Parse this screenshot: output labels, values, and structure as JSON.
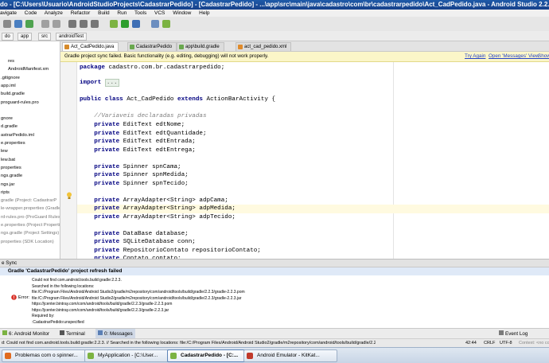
{
  "window": {
    "title": "do - [C:\\Users\\Usuario\\AndroidStudioProjects\\CadastrarPedido] - [CadastrarPedido] - ...\\app\\src\\main\\java\\cadastro\\com\\br\\cadastrarpedido\\Act_CadPedido.java - Android Studio 2.2.3"
  },
  "menu": [
    "avigate",
    "Code",
    "Analyze",
    "Refactor",
    "Build",
    "Run",
    "Tools",
    "VCS",
    "Window",
    "Help"
  ],
  "breadcrumbs": [
    "do",
    "app",
    "src",
    "androidTest"
  ],
  "project_tree": [
    {
      "label": "res",
      "style": "normal"
    },
    {
      "label": "AndroidManifest.xm",
      "style": "normal"
    },
    {
      "label": ".gitignore",
      "style": "normal"
    },
    {
      "label": "app.iml",
      "style": "normal"
    },
    {
      "label": "build.gradle",
      "style": "normal"
    },
    {
      "label": "proguard-rules.pro",
      "style": "normal"
    },
    {
      "label": "",
      "style": "normal"
    },
    {
      "label": "gnore",
      "style": "normal"
    },
    {
      "label": "d.gradle",
      "style": "normal"
    },
    {
      "label": "astrarPedido.iml",
      "style": "normal"
    },
    {
      "label": "e.properties",
      "style": "normal"
    },
    {
      "label": "lew",
      "style": "normal"
    },
    {
      "label": "lew.bat",
      "style": "normal"
    },
    {
      "label": "properties",
      "style": "normal"
    },
    {
      "label": "ngs.gradle",
      "style": "normal"
    },
    {
      "label": "ngs.jar",
      "style": "normal"
    },
    {
      "label": "ripts",
      "style": "normal"
    },
    {
      "label": "gradle (Project: CadastrarP",
      "style": "grey"
    },
    {
      "label": "le-wrapper.properties (Gradle",
      "style": "grey"
    },
    {
      "label": "rd-rules.pro (ProGuard Rules f",
      "style": "grey"
    },
    {
      "label": "e.properties (Project Propertie",
      "style": "grey"
    },
    {
      "label": "ngs.gradle (Project Settings)",
      "style": "grey"
    },
    {
      "label": "properties (SDK Location)",
      "style": "grey"
    }
  ],
  "editor_tabs": [
    {
      "label": "Act_CadPedido.java",
      "active": true,
      "color": "#d68a2a"
    },
    {
      "label": "CadastrarPedido",
      "active": false,
      "color": "#6aa84f"
    },
    {
      "label": "app\\build.gradle",
      "active": false,
      "color": "#6aa84f"
    },
    {
      "label": "act_cad_pedido.xml",
      "active": false,
      "color": "#e08b2b"
    }
  ],
  "notice": {
    "text": "Gradle project sync failed. Basic functionality (e.g. editing, debugging) will not work properly.",
    "try_again": "Try Again",
    "open_messages": "Open 'Messages' View",
    "show": "Show"
  },
  "code": {
    "package_kw": "package",
    "package_name": " cadastro.com.br.cadastrarpedido;",
    "import_kw": "import",
    "import_rest": "...",
    "class_decl_1": "public class",
    "class_decl_2": " Act_CadPedido ",
    "class_decl_3": "extends",
    "class_decl_4": " ActionBarActivity {",
    "comment": "//Variaveis declaradas privadas",
    "private_kw": "private",
    "fields": [
      " EditText edtNome;",
      " EditText edtQuantidade;",
      " EditText edtEntrada;",
      " EditText edtEntrega;",
      "",
      " Spinner spnCama;",
      " Spinner spnMedida;",
      " Spinner spnTecido;",
      "",
      " ArrayAdapter<String> adpCama;",
      " ArrayAdapter<String> adpMedida;",
      " ArrayAdapter<String> adpTecido;",
      "",
      " DataBase database;",
      " SQLiteDatabase conn;",
      " RepositorioContato repositorioContato;",
      " Contato contato;"
    ]
  },
  "sync": {
    "panel_label": "e Sync",
    "title": "Gradle 'CadastrarPedido' project refresh failed",
    "error_label": "Error:",
    "lines": [
      "Could not find com.android.tools.build:gradle:2.2.3.",
      "Searched in the following locations:",
      "file:/C:/Program Files/Android/Android Studio2/gradle/m2repository/com/android/tools/build/gradle/2.2.3/gradle-2.2.3.pom",
      "file:/C:/Program Files/Android/Android Studio2/gradle/m2repository/com/android/tools/build/gradle/2.2.3/gradle-2.2.3.jar",
      "https://jcenter.bintray.com/com/android/tools/build/gradle/2.2.3/gradle-2.2.3.pom",
      "https://jcenter.bintray.com/com/android/tools/build/gradle/2.2.3/gradle-2.2.3.jar",
      "Required by:",
      "  :CadastrarPedido:unspecified"
    ]
  },
  "bottom_tabs": {
    "android_monitor": "6: Android Monitor",
    "terminal": "Terminal",
    "messages": "0: Messages",
    "event_log": "Event Log",
    "gradle_console": "Gradle Console"
  },
  "status": {
    "message": "d: Could not find com.android.tools.build:gradle:2.2.3. // Searched in the following locations:    file:/C:/Program Files/Android/Android Studio2/gradle/m2repository/com/android/tools/build/gradle/2.2.3/gradle-2... (a minute ago)",
    "position": "42:44",
    "line_sep": "CRLF",
    "encoding": "UTF-8",
    "context": "Context: <no conte"
  },
  "taskbar": [
    {
      "label": "Problemas com o spinner...",
      "active": false,
      "color": "#e06b1f"
    },
    {
      "label": "MyApplication - [C:\\User...",
      "active": false,
      "color": "#7cb342"
    },
    {
      "label": "CadastrarPedido - [C:...",
      "active": true,
      "color": "#7cb342"
    },
    {
      "label": "Android Emulator - KitKat...",
      "active": false,
      "color": "#c0392b"
    }
  ]
}
